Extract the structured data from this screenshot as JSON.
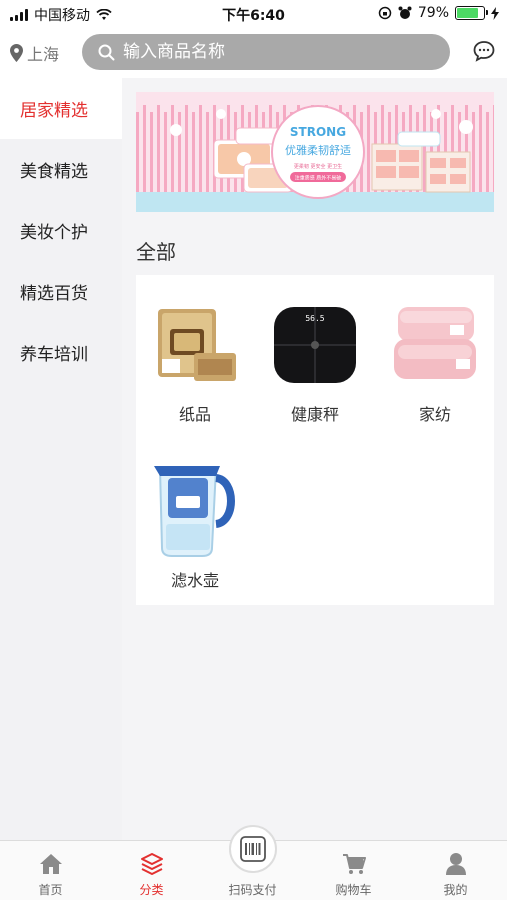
{
  "status_bar": {
    "carrier": "中国移动",
    "time": "下午6:40",
    "battery": "79%",
    "battery_level": 0.79
  },
  "header": {
    "location": "上海",
    "search_placeholder": "输入商品名称",
    "icons": {
      "location": "location-pin-icon",
      "search": "search-icon",
      "message": "chat-bubble-icon"
    }
  },
  "sidebar": {
    "items": [
      {
        "label": "居家精选",
        "active": true
      },
      {
        "label": "美食精选",
        "active": false
      },
      {
        "label": "美妆个护",
        "active": false
      },
      {
        "label": "精选百货",
        "active": false
      },
      {
        "label": "养车培训",
        "active": false
      }
    ]
  },
  "banner": {
    "title": "STRONG",
    "subtitle": "优雅柔韧舒适",
    "tagline": "注重质感 质外不易破",
    "small_text": "更柔韧 更安全 更卫生"
  },
  "main": {
    "section_title": "全部",
    "products": [
      {
        "label": "纸品",
        "icon": "tissue-pack-icon"
      },
      {
        "label": "健康秤",
        "icon": "bathroom-scale-icon"
      },
      {
        "label": "家纺",
        "icon": "folded-blanket-icon"
      },
      {
        "label": "滤水壶",
        "icon": "water-filter-pitcher-icon"
      }
    ],
    "scale_reading": "56.5"
  },
  "tabbar": {
    "tabs": [
      {
        "label": "首页",
        "icon": "home-icon",
        "active": false
      },
      {
        "label": "分类",
        "icon": "category-layers-icon",
        "active": true
      },
      {
        "label": "扫码支付",
        "icon": "barcode-scan-icon",
        "active": false
      },
      {
        "label": "购物车",
        "icon": "cart-icon",
        "active": false
      },
      {
        "label": "我的",
        "icon": "user-icon",
        "active": false
      }
    ]
  },
  "colors": {
    "accent": "#e3302f",
    "search_bg": "#a9a9a9",
    "battery": "#4cd964"
  }
}
